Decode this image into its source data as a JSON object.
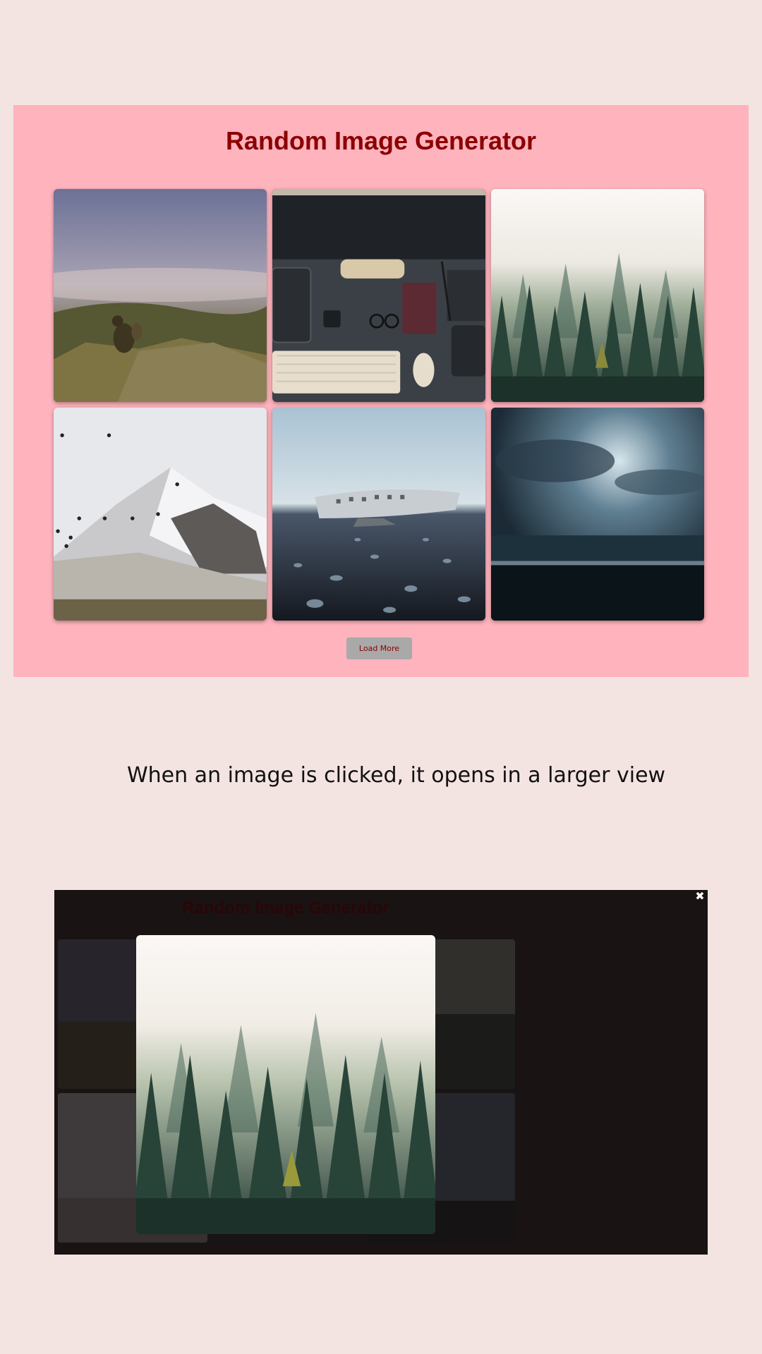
{
  "app": {
    "title": "Random Image Generator",
    "load_more_label": "Load More",
    "images": [
      {
        "name": "mountain-hiker-photo",
        "scene": "mountain"
      },
      {
        "name": "desk-workspace-photo",
        "scene": "desk"
      },
      {
        "name": "foggy-forest-photo",
        "scene": "forest"
      },
      {
        "name": "snowy-peak-photo",
        "scene": "snow"
      },
      {
        "name": "plane-wreck-photo",
        "scene": "plane"
      },
      {
        "name": "stormy-sea-photo",
        "scene": "storm"
      }
    ]
  },
  "caption": "When an image is clicked, it opens in a larger view",
  "lightbox": {
    "background_title": "Random Image Generator",
    "close_icon": "close-icon",
    "selected_image": "foggy-forest-photo"
  },
  "colors": {
    "page_bg": "#f3e4e2",
    "app_bg": "#ffb3bd",
    "title": "#8b0000",
    "button_bg": "#a9a9a9",
    "overlay_bg": "#191314"
  }
}
